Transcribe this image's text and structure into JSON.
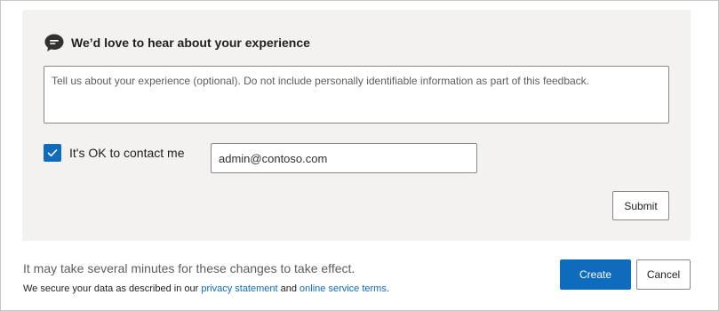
{
  "feedback": {
    "title": "We’d love to hear about your experience",
    "icon": "chat-bubble-icon",
    "textarea_placeholder": "Tell us about your experience (optional). Do not include personally identifiable information as part of this feedback.",
    "textarea_value": "",
    "contact_checkbox_checked": true,
    "contact_label": "It's OK to contact me",
    "email_value": "admin@contoso.com",
    "submit_label": "Submit"
  },
  "footer": {
    "notice": "It may take several minutes for these changes to take effect.",
    "privacy_prefix": "We secure your data as described in our ",
    "privacy_link": "privacy statement",
    "privacy_middle": " and ",
    "terms_link": "online service terms",
    "privacy_suffix": ".",
    "create_label": "Create",
    "cancel_label": "Cancel"
  },
  "colors": {
    "accent": "#0f6cbd",
    "panel_background": "#f3f2f1",
    "border": "#8a8886"
  }
}
